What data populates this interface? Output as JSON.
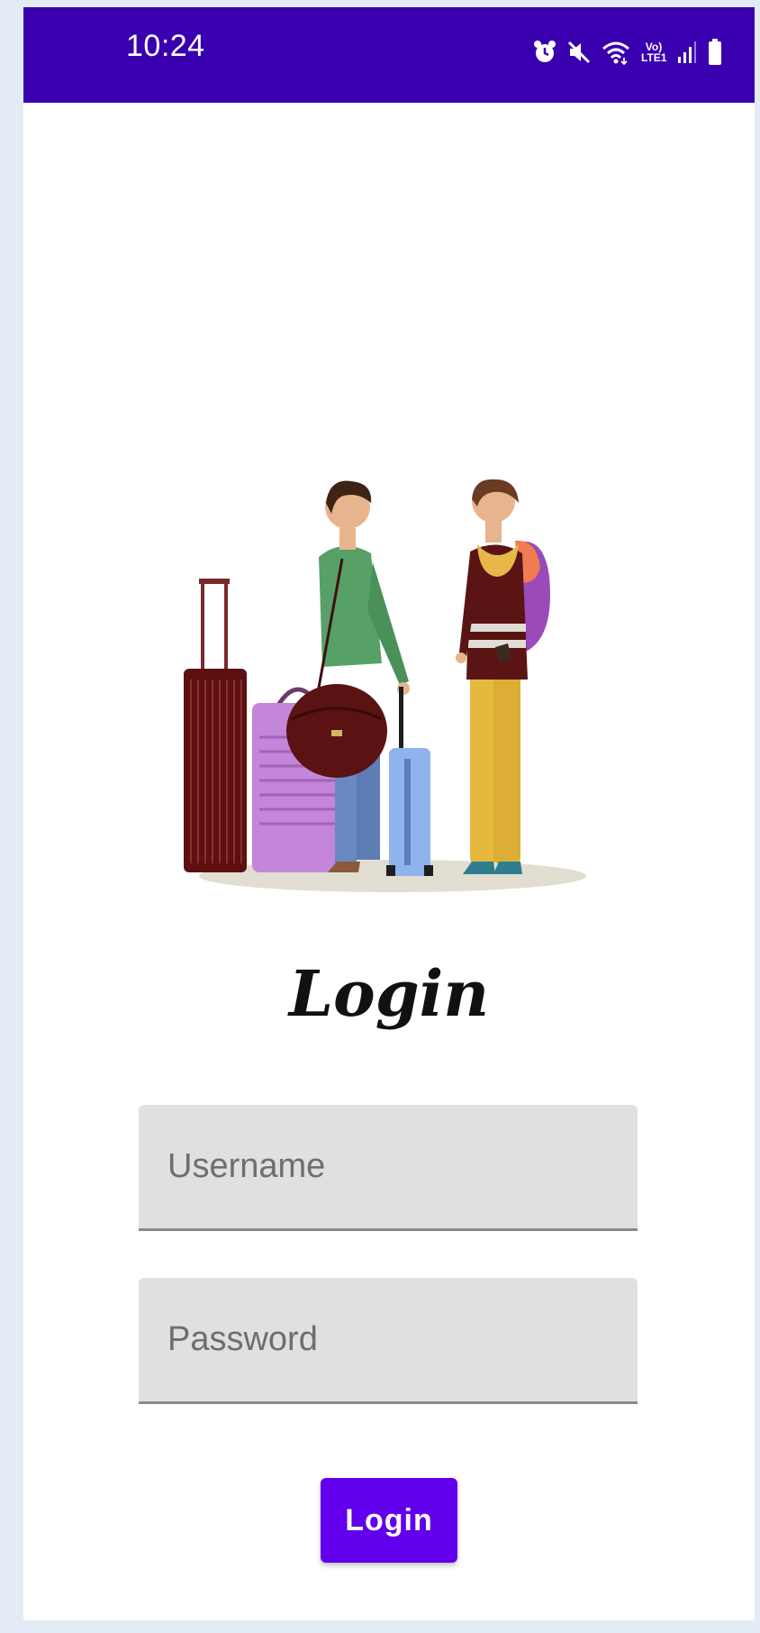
{
  "status_bar": {
    "time": "10:24",
    "network_label": "Vo) LTE1",
    "icons": [
      "alarm-icon",
      "mute-icon",
      "wifi-icon",
      "volte-lte-icon",
      "signal-icon",
      "battery-icon"
    ],
    "background_color": "#3a00b0"
  },
  "illustration": {
    "icon": "travelers-with-luggage-illustration"
  },
  "login": {
    "title": "Login",
    "username_placeholder": "Username",
    "password_placeholder": "Password",
    "button_label": "Login",
    "button_color": "#6200ee"
  }
}
